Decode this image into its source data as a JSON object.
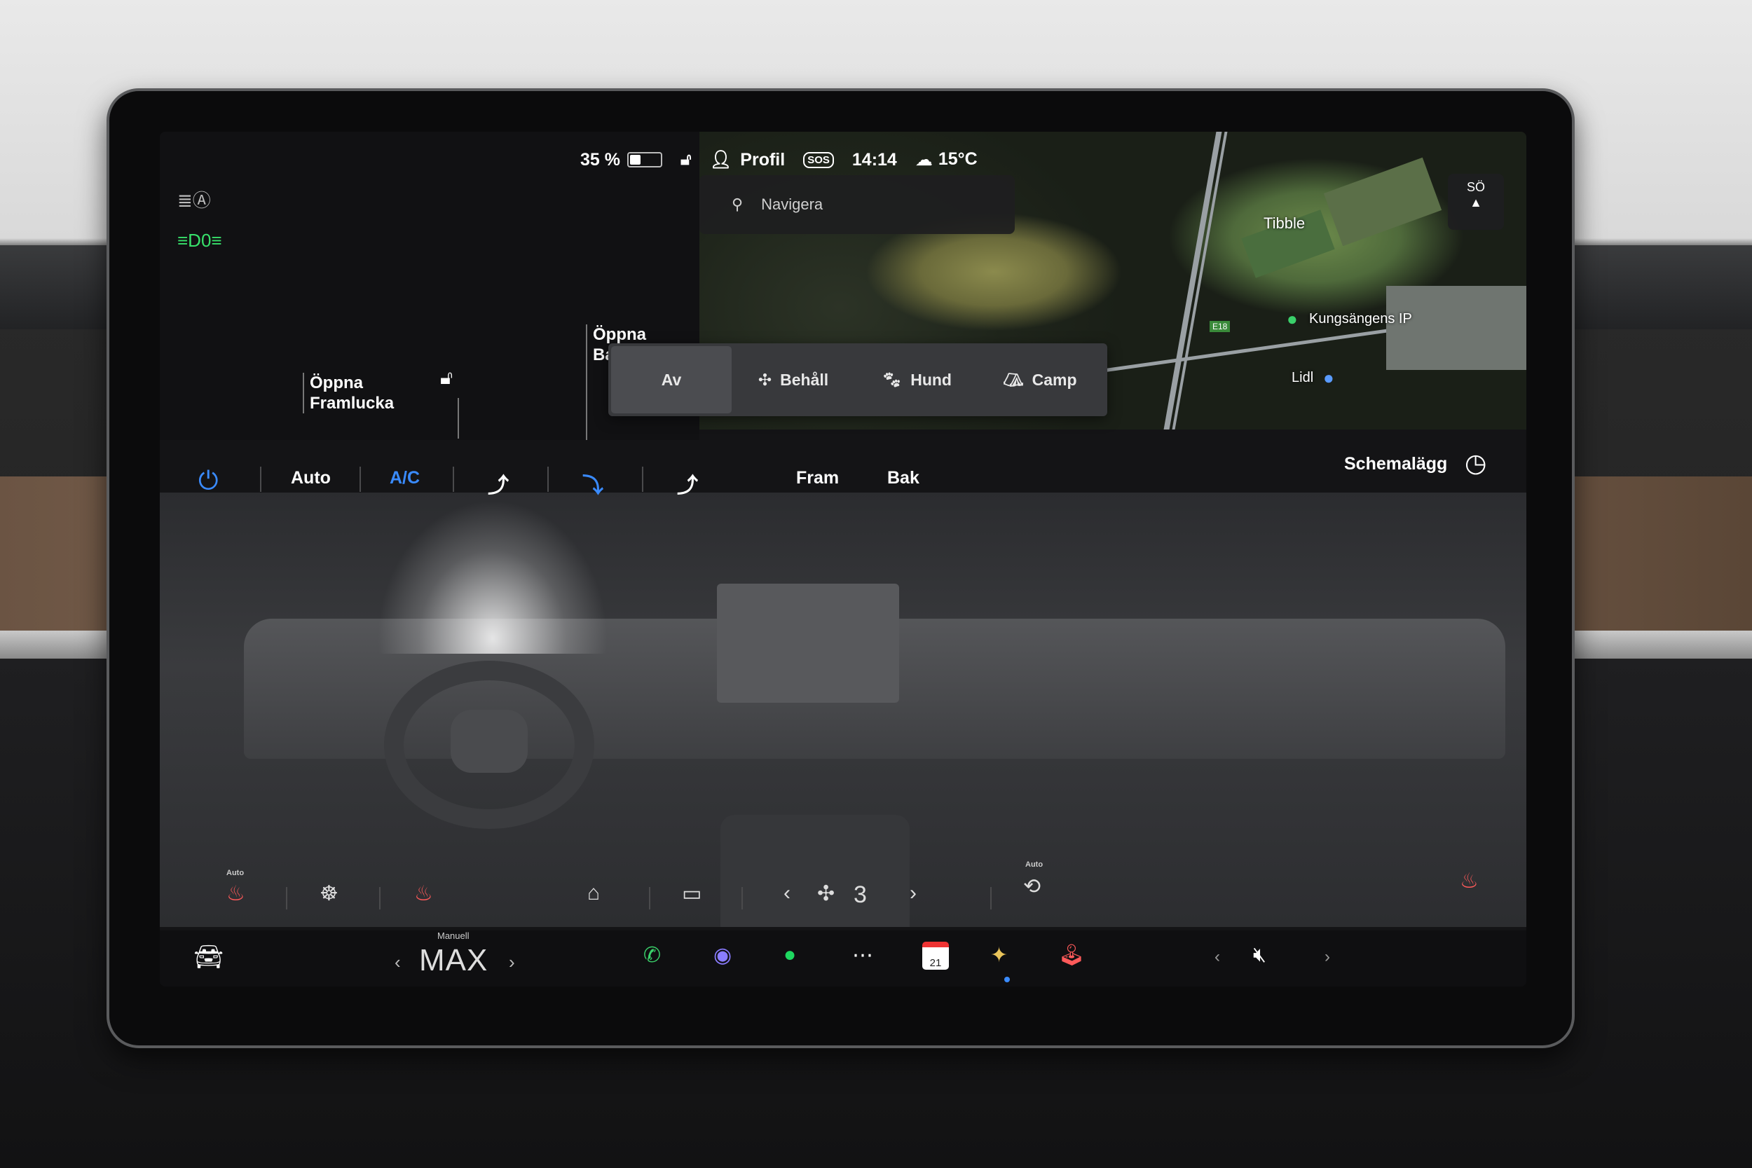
{
  "status": {
    "battery_percent": "35 %",
    "battery_level": 0.35,
    "profile_label": "Profil",
    "sos_label": "SOS",
    "time": "14:14",
    "temperature": "15°C"
  },
  "lights": {
    "auto_headlights_icon": "auto-headlight-icon",
    "parking_lights_icon": "parking-light-icon"
  },
  "car": {
    "frunk_label_line1": "Öppna",
    "frunk_label_line2": "Framlucka",
    "trunk_label_line1": "Öppna",
    "trunk_label_line2": "Ba"
  },
  "map": {
    "search_placeholder": "Navigera",
    "compass_heading": "SÖ",
    "place_tibble": "Tibble",
    "place_kungsangens": "Kungsängens IP",
    "place_lidl": "Lidl",
    "road_label": "E18"
  },
  "keeper": {
    "options": [
      {
        "label": "Av",
        "icon": ""
      },
      {
        "label": "Behåll",
        "icon": "fan-icon"
      },
      {
        "label": "Hund",
        "icon": "paw-icon"
      },
      {
        "label": "Camp",
        "icon": "tent-icon"
      }
    ],
    "selected": "Av"
  },
  "climate": {
    "auto_label": "Auto",
    "ac_label": "A/C",
    "front_label": "Fram",
    "rear_label": "Bak",
    "schedule_label": "Schemalägg",
    "fan_speed": "3",
    "seat_heat_auto": "Auto",
    "recirc_auto": "Auto"
  },
  "dock": {
    "manual_label": "Manuell",
    "max_label": "MAX",
    "calendar_day": "21"
  },
  "colors": {
    "accent_blue": "#3a8bff",
    "green_light": "#37e06a",
    "screen_bg": "#141416"
  }
}
